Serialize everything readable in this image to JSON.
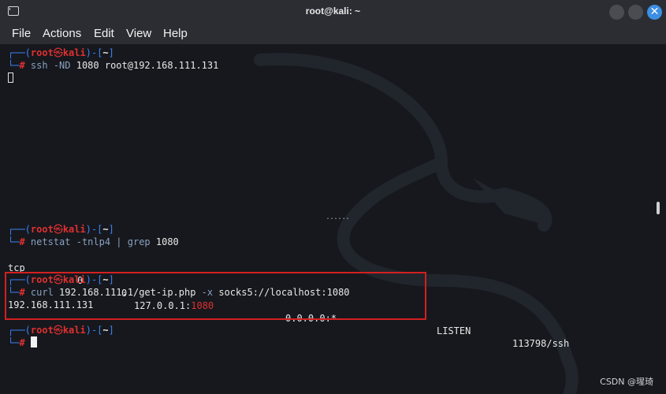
{
  "window": {
    "title": "root@kali: ~",
    "close_glyph": "✕"
  },
  "menu": [
    "File",
    "Actions",
    "Edit",
    "View",
    "Help"
  ],
  "prompt": {
    "open": "┌──(",
    "user": "root",
    "skull": "㉿",
    "host": "kali",
    "close": ")-[",
    "dir": "~",
    "end": "]",
    "line2": "└─",
    "hash": "#"
  },
  "blocks": [
    {
      "cmd": "ssh",
      "args": " -ND ",
      "rest": "1080 root@192.168.111.131"
    },
    {
      "cmd": "netstat",
      "args": " -tnlp4 ",
      "pipe": "|",
      "cmd2": " grep",
      "rest": " 1080"
    },
    {
      "cmd": "curl",
      "args": " 192.168.111.1/get-ip.php ",
      "opt": "-x",
      "rest": " socks5://localhost:1080"
    }
  ],
  "netstat_row": {
    "proto": "tcp",
    "recvq": "0",
    "sendq": "0",
    "local_prefix": "127.0.0.1:",
    "local_port": "1080",
    "foreign": "0.0.0.0:*",
    "state": "LISTEN",
    "pid": "113798/ssh"
  },
  "curl_output": "192.168.111.131",
  "separator": "......",
  "watermark": "CSDN @瑆琦"
}
